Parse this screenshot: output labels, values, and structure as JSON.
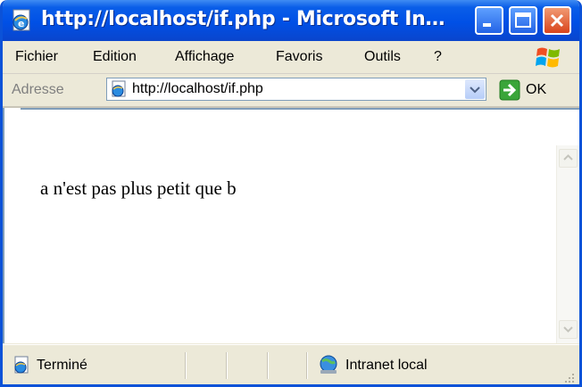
{
  "window": {
    "title": "http://localhost/if.php - Microsoft In…"
  },
  "menubar": {
    "items": [
      {
        "label": "Fichier"
      },
      {
        "label": "Edition"
      },
      {
        "label": "Affichage"
      },
      {
        "label": "Favoris"
      },
      {
        "label": "Outils"
      },
      {
        "label": "?"
      }
    ]
  },
  "addressbar": {
    "label": "Adresse",
    "url": "http://localhost/if.php",
    "go_label": "OK"
  },
  "page": {
    "text": "a n'est pas plus petit que b"
  },
  "statusbar": {
    "status": "Terminé",
    "zone": "Intranet local"
  },
  "icons": {
    "app": "ie-page-icon",
    "minimize": "minimize-icon",
    "maximize": "maximize-icon",
    "close": "close-icon",
    "windows_logo": "windows-logo-icon",
    "go": "go-arrow-icon",
    "dropdown": "chevron-down-icon",
    "status": "ie-page-icon",
    "zone": "intranet-globe-icon"
  },
  "colors": {
    "titlebar": "#0050e6",
    "close_button": "#d9441c",
    "go_button": "#3aa53a"
  }
}
